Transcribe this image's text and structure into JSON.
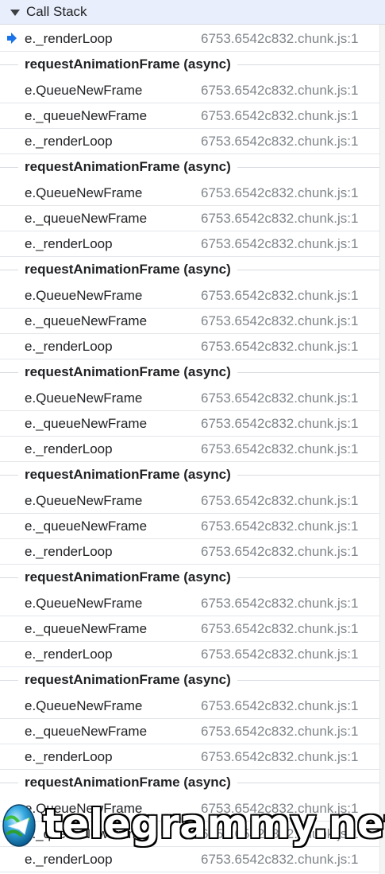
{
  "panel": {
    "title": "Call Stack"
  },
  "colors": {
    "header_bg": "#e8eefb",
    "arrow": "#1a73e8",
    "location_text": "#80868b"
  },
  "frames": [
    {
      "name": "e._renderLoop",
      "location": "6753.6542c832.chunk.js:1",
      "current": true
    },
    {
      "name": "requestAnimationFrame (async)",
      "async": true
    },
    {
      "name": "e.QueueNewFrame",
      "location": "6753.6542c832.chunk.js:1"
    },
    {
      "name": "e._queueNewFrame",
      "location": "6753.6542c832.chunk.js:1"
    },
    {
      "name": "e._renderLoop",
      "location": "6753.6542c832.chunk.js:1"
    },
    {
      "name": "requestAnimationFrame (async)",
      "async": true
    },
    {
      "name": "e.QueueNewFrame",
      "location": "6753.6542c832.chunk.js:1"
    },
    {
      "name": "e._queueNewFrame",
      "location": "6753.6542c832.chunk.js:1"
    },
    {
      "name": "e._renderLoop",
      "location": "6753.6542c832.chunk.js:1"
    },
    {
      "name": "requestAnimationFrame (async)",
      "async": true
    },
    {
      "name": "e.QueueNewFrame",
      "location": "6753.6542c832.chunk.js:1"
    },
    {
      "name": "e._queueNewFrame",
      "location": "6753.6542c832.chunk.js:1"
    },
    {
      "name": "e._renderLoop",
      "location": "6753.6542c832.chunk.js:1"
    },
    {
      "name": "requestAnimationFrame (async)",
      "async": true
    },
    {
      "name": "e.QueueNewFrame",
      "location": "6753.6542c832.chunk.js:1"
    },
    {
      "name": "e._queueNewFrame",
      "location": "6753.6542c832.chunk.js:1"
    },
    {
      "name": "e._renderLoop",
      "location": "6753.6542c832.chunk.js:1"
    },
    {
      "name": "requestAnimationFrame (async)",
      "async": true
    },
    {
      "name": "e.QueueNewFrame",
      "location": "6753.6542c832.chunk.js:1"
    },
    {
      "name": "e._queueNewFrame",
      "location": "6753.6542c832.chunk.js:1"
    },
    {
      "name": "e._renderLoop",
      "location": "6753.6542c832.chunk.js:1"
    },
    {
      "name": "requestAnimationFrame (async)",
      "async": true
    },
    {
      "name": "e.QueueNewFrame",
      "location": "6753.6542c832.chunk.js:1"
    },
    {
      "name": "e._queueNewFrame",
      "location": "6753.6542c832.chunk.js:1"
    },
    {
      "name": "e._renderLoop",
      "location": "6753.6542c832.chunk.js:1"
    },
    {
      "name": "requestAnimationFrame (async)",
      "async": true
    },
    {
      "name": "e.QueueNewFrame",
      "location": "6753.6542c832.chunk.js:1"
    },
    {
      "name": "e._queueNewFrame",
      "location": "6753.6542c832.chunk.js:1"
    },
    {
      "name": "e._renderLoop",
      "location": "6753.6542c832.chunk.js:1"
    },
    {
      "name": "requestAnimationFrame (async)",
      "async": true
    },
    {
      "name": "e.QueueNewFrame",
      "location": "6753.6542c832.chunk.js:1"
    },
    {
      "name": "e._queueNewFrame",
      "location": "6753.6542c832.chunk.js:1"
    },
    {
      "name": "e._renderLoop",
      "location": "6753.6542c832.chunk.js:1"
    }
  ],
  "watermark": {
    "text": "telegrammy.net",
    "logo_icon": "telegram-globe-logo"
  }
}
